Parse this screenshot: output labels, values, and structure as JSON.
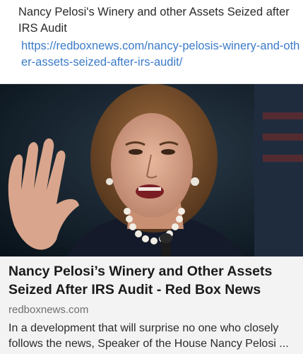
{
  "post": {
    "text": "Nancy Pelosi's Winery and other Assets Seized after IRS Audit",
    "link": "https://redboxnews.com/nancy-pelosis-winery-and-other-assets-seized-after-irs-audit/"
  },
  "link_preview": {
    "image_icon": "photo-of-speaker",
    "title": "Nancy Pelosi’s Winery and Other Assets Seized After IRS Audit - Red Box News",
    "domain": "redboxnews.com",
    "description": "In a development that will surprise no one who closely follows the news, Speaker of the House Nancy Pelosi ..."
  },
  "colors": {
    "link": "#3b7bc8",
    "preview_background": "#f3f3f4",
    "title_text": "#1a1a1a",
    "domain_text": "#707070"
  }
}
